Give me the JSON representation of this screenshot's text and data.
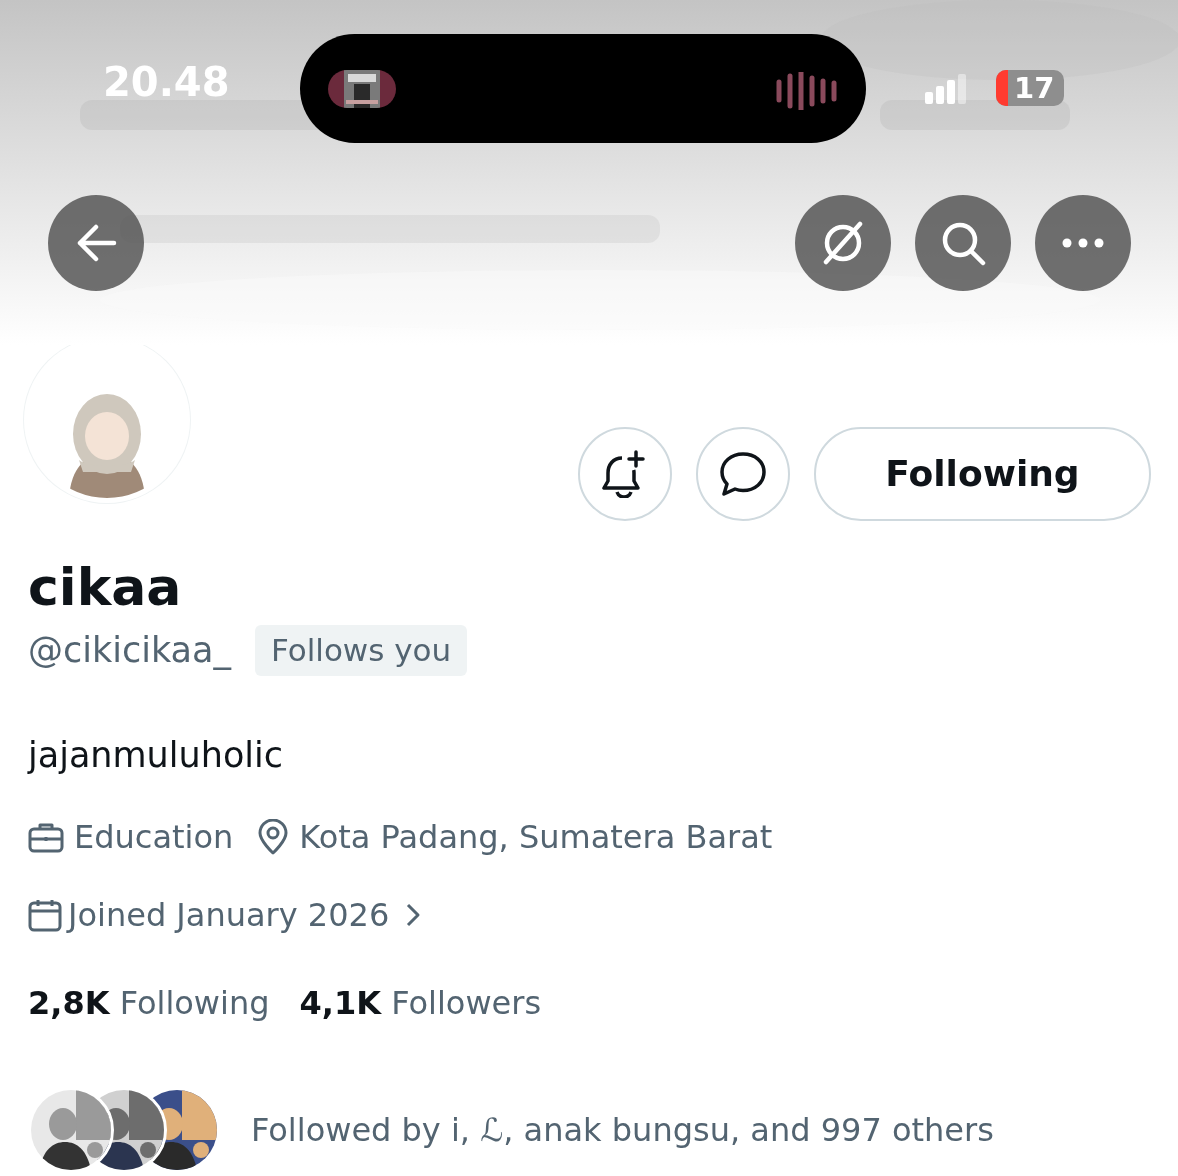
{
  "status_bar": {
    "time": "20.48",
    "battery": "17"
  },
  "profile": {
    "name": "cikaa",
    "handle": "@cikicikaa_",
    "badge": "Follows you",
    "bio": "jajanmuluholic",
    "details": [
      {
        "kind": "category",
        "text": "Education"
      },
      {
        "kind": "location",
        "text": "Kota Padang, Sumatera Barat"
      }
    ],
    "joined": "Joined January 2026",
    "stats": [
      {
        "count": "2,8K",
        "label": "Following"
      },
      {
        "count": "4,1K",
        "label": "Followers"
      }
    ],
    "followed_by": {
      "text": "Followed by i, ℒ, anak bungsu, and 997 others"
    }
  },
  "follow_button": {
    "label": "Following"
  }
}
